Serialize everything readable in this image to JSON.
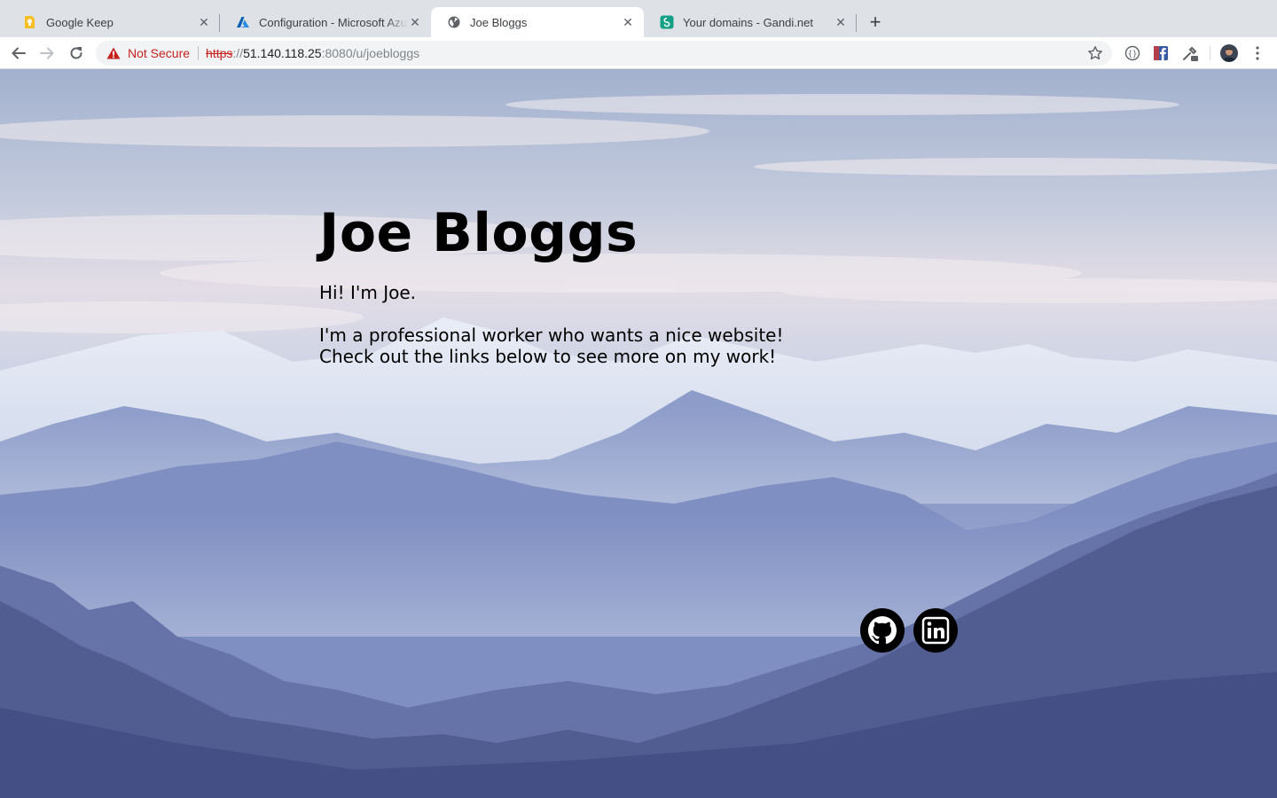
{
  "browser": {
    "tabs": [
      {
        "title": "Google Keep",
        "favicon": "google-keep-icon",
        "active": false
      },
      {
        "title": "Configuration - Microsoft Azure",
        "favicon": "azure-icon",
        "active": false
      },
      {
        "title": "Joe Bloggs",
        "favicon": "globe-icon",
        "active": true
      },
      {
        "title": "Your domains - Gandi.net",
        "favicon": "gandi-icon",
        "active": false
      }
    ],
    "close_glyph": "✕",
    "new_tab_glyph": "+",
    "security_label": "Not Secure",
    "url": {
      "scheme": "https",
      "separator": "://",
      "host": "51.140.118.25",
      "rest": ":8080/u/joebloggs"
    },
    "colors": {
      "tabstrip": "#dee1e6",
      "insecure": "#c5221f"
    }
  },
  "page": {
    "name": "Joe Bloggs",
    "intro": "Hi! I'm Joe.",
    "bio_lines": [
      "I'm a professional worker who wants a nice website!",
      "Check out the links below to see more on my work!"
    ],
    "social_links": [
      {
        "icon": "github-icon"
      },
      {
        "icon": "linkedin-icon"
      }
    ],
    "background": "mountain-landscape"
  }
}
